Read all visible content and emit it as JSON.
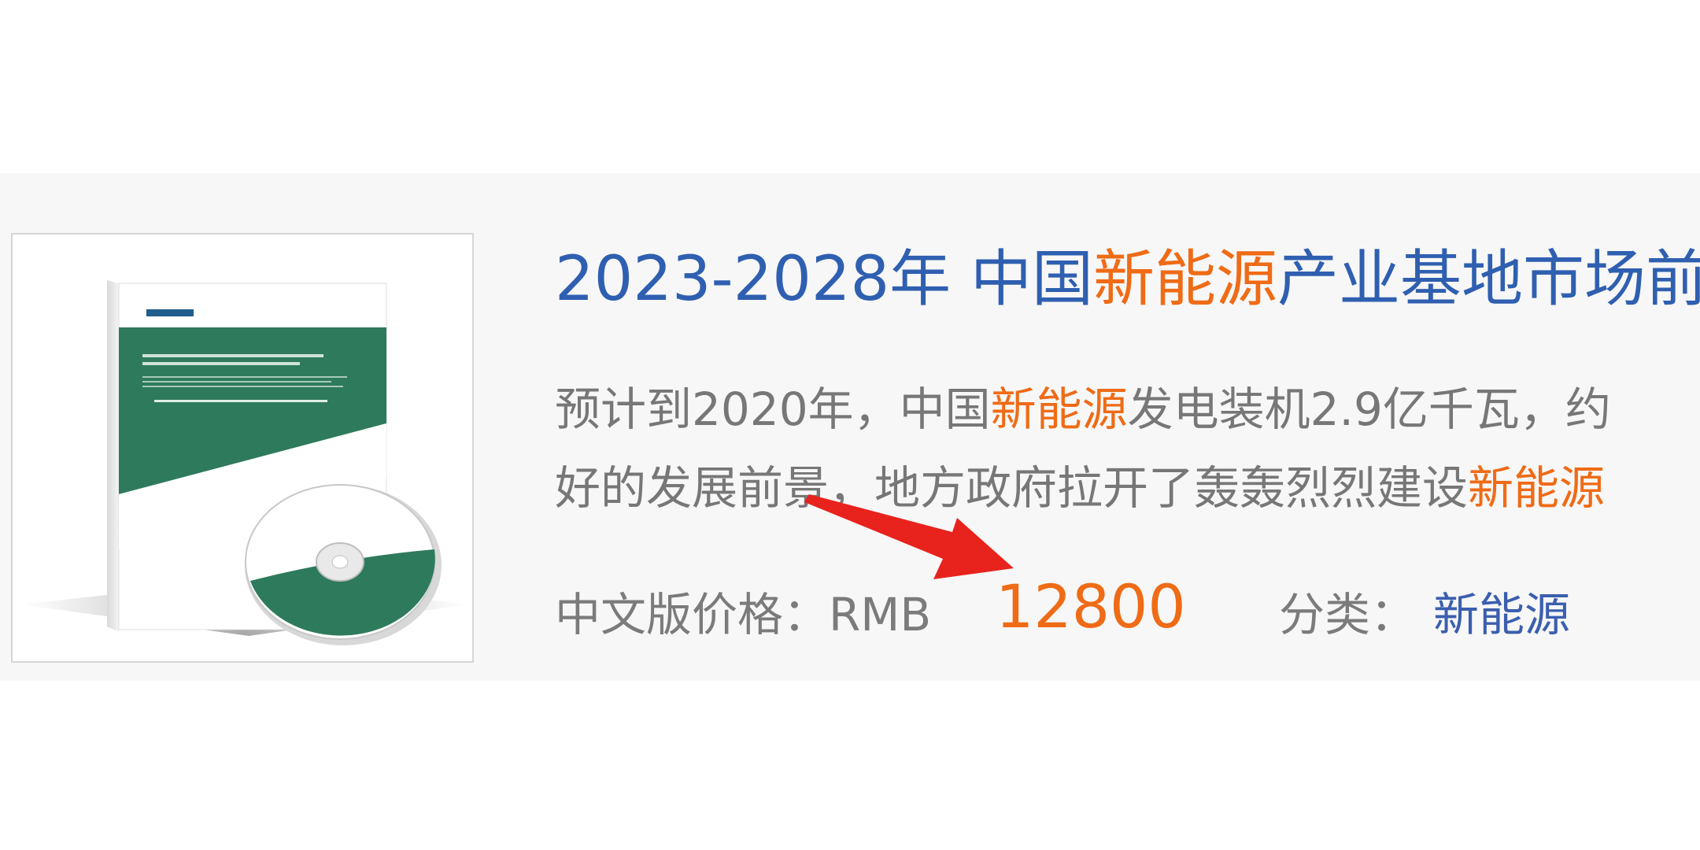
{
  "report": {
    "title_prefix": "2023-2028年 中国",
    "title_highlight": "新能源",
    "title_suffix": "产业基地市场前",
    "summary_l1_prefix": "预计到2020年，中国",
    "summary_l1_highlight": "新能源",
    "summary_l1_suffix": "发电装机2.9亿千瓦，约",
    "summary_l2_prefix": "好的发展前景，地方政府拉开了轰轰烈烈建设",
    "summary_l2_highlight": "新能源",
    "price_label": "中文版价格：RMB",
    "price_value": "12800",
    "category_label": "分类：",
    "category_value": "新能源"
  },
  "colors": {
    "title": "#2f5fb0",
    "highlight": "#ef6b16",
    "body_text": "#777777",
    "card_bg": "#f7f7f7",
    "cover_green": "#2e7a5c",
    "arrow": "#e8221c"
  },
  "icons": {
    "annotation": "red-arrow-icon"
  }
}
